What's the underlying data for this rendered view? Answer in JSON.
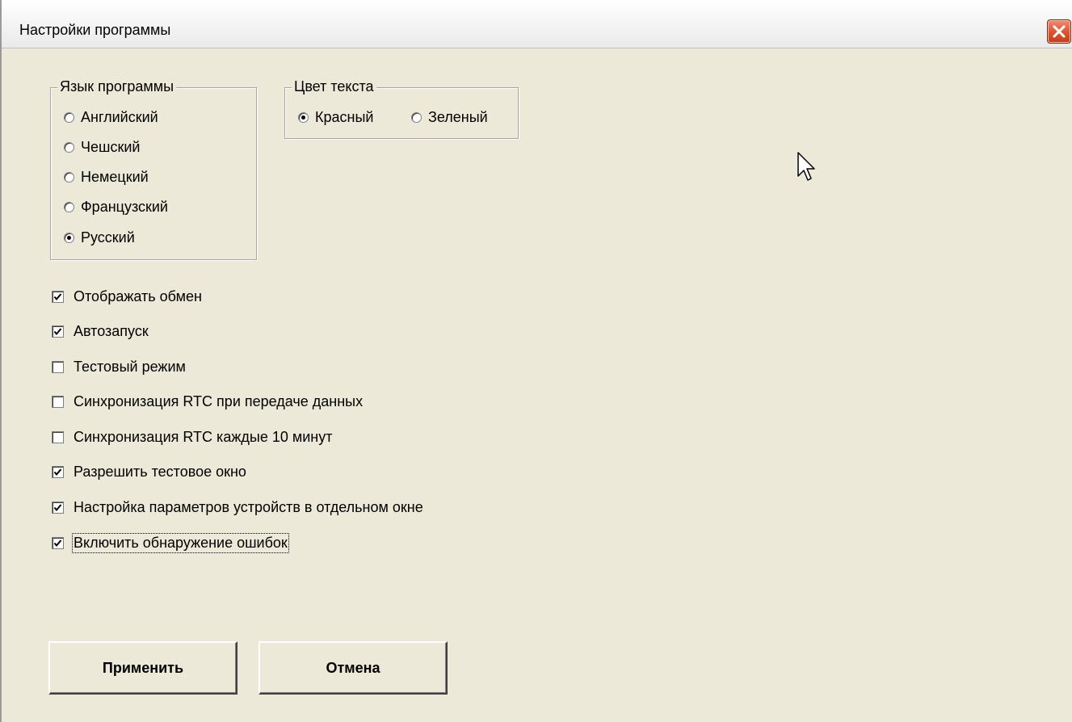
{
  "window": {
    "title": "Настройки программы"
  },
  "language_group": {
    "legend": "Язык программы",
    "options": [
      {
        "label": "Английский",
        "selected": false
      },
      {
        "label": "Чешский",
        "selected": false
      },
      {
        "label": "Немецкий",
        "selected": false
      },
      {
        "label": "Французский",
        "selected": false
      },
      {
        "label": "Русский",
        "selected": true
      }
    ]
  },
  "color_group": {
    "legend": "Цвет текста",
    "options": [
      {
        "label": "Красный",
        "selected": true
      },
      {
        "label": "Зеленый",
        "selected": false
      }
    ]
  },
  "checkboxes": [
    {
      "label": "Отображать обмен",
      "checked": true
    },
    {
      "label": "Автозапуск",
      "checked": true
    },
    {
      "label": "Тестовый режим",
      "checked": false
    },
    {
      "label": "Синхронизация RTC при передаче данных",
      "checked": false
    },
    {
      "label": "Синхронизация RTC каждые 10 минут",
      "checked": false
    },
    {
      "label": "Разрешить тестовое окно",
      "checked": true
    },
    {
      "label": "Настройка параметров устройств в отдельном окне",
      "checked": true
    },
    {
      "label": "Включить обнаружение ошибок",
      "checked": true,
      "focused": true
    }
  ],
  "buttons": {
    "apply": "Применить",
    "cancel": "Отмена"
  },
  "colors": {
    "dialog_bg": "#ece9d8",
    "close_red": "#d9532f"
  },
  "icons": {
    "close": "close-icon",
    "cursor": "mouse-pointer-icon",
    "check": "checkmark-icon"
  }
}
